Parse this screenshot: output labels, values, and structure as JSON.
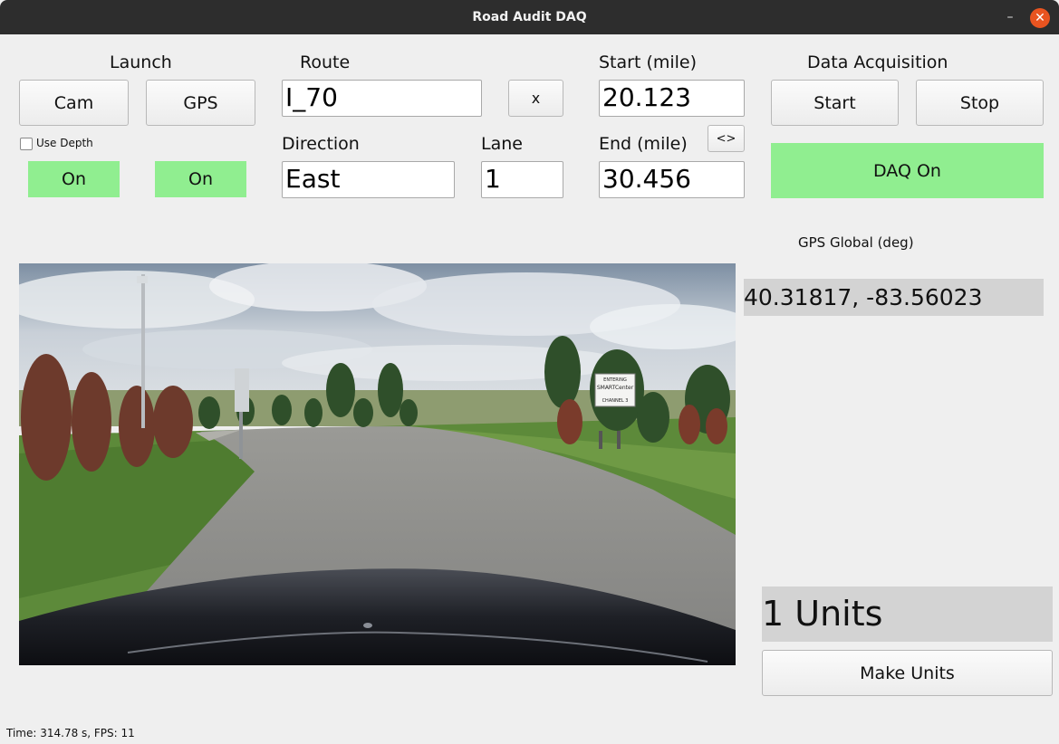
{
  "window": {
    "title": "Road Audit DAQ"
  },
  "launch": {
    "heading": "Launch",
    "cam_button": "Cam",
    "gps_button": "GPS",
    "use_depth_label": "Use Depth",
    "use_depth_checked": false,
    "cam_status": "On",
    "gps_status": "On",
    "status_on_color": "#90ee90"
  },
  "route": {
    "label": "Route",
    "value": "I_70",
    "clear_button": "x",
    "direction_label": "Direction",
    "direction_value": "East",
    "lane_label": "Lane",
    "lane_value": "1"
  },
  "mileage": {
    "start_label": "Start (mile)",
    "start_value": "20.123",
    "swap_button": "<>",
    "end_label": "End (mile)",
    "end_value": "30.456"
  },
  "daq": {
    "heading": "Data Acquisition",
    "start_button": "Start",
    "stop_button": "Stop",
    "status": "DAQ On"
  },
  "gps": {
    "label": "GPS Global (deg)",
    "coords": "40.31817, -83.56023"
  },
  "units": {
    "count_text": "1 Units",
    "make_button": "Make Units"
  },
  "status_bar": {
    "text": "Time: 314.78 s, FPS: 11"
  },
  "camera_feed": {
    "icon": "camera-feed-image",
    "sign_line1": "ENTERING",
    "sign_line2": "SMARTCenter",
    "sign_line3": "CHANNEL 3"
  }
}
